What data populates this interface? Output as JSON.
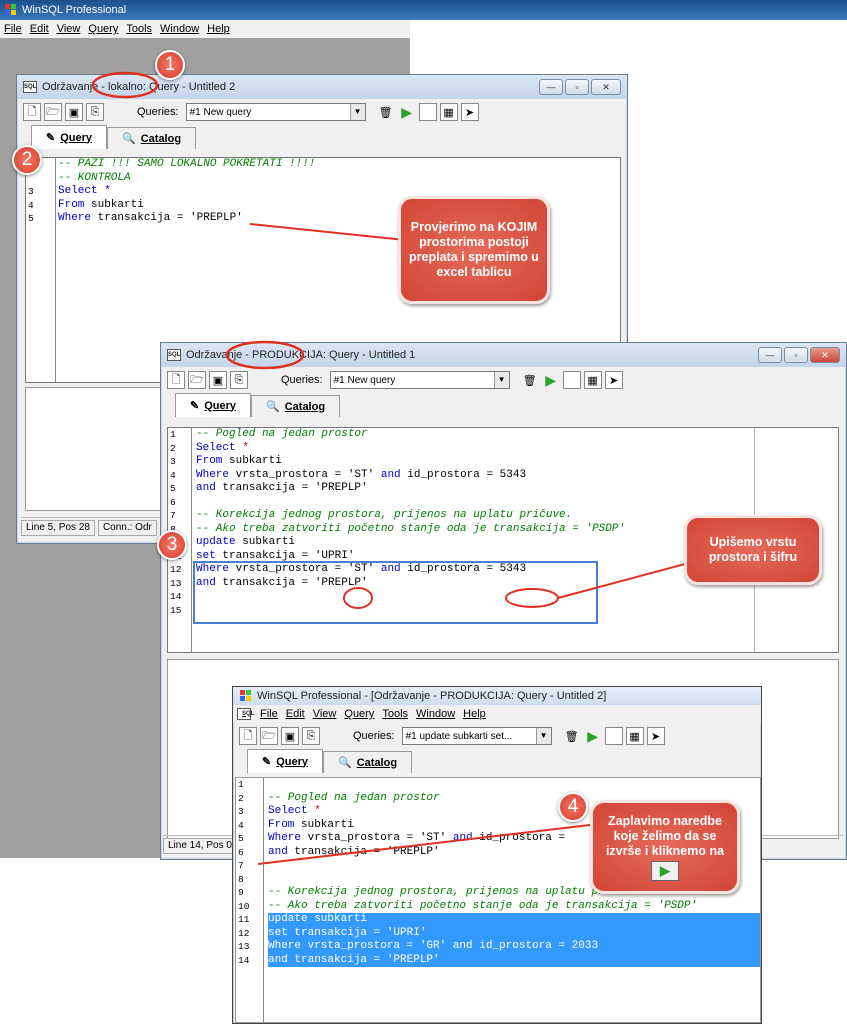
{
  "app_title": "WinSQL Professional",
  "menu": [
    "File",
    "Edit",
    "View",
    "Query",
    "Tools",
    "Window",
    "Help"
  ],
  "win1": {
    "title": "Održavanje - lokalno: Query - Untitled 2",
    "queries_label": "Queries:",
    "queries_value": "#1 New query",
    "tab_query": "Query",
    "tab_catalog": "Catalog",
    "line_numbers": [
      "",
      "",
      "3",
      "4",
      "5"
    ],
    "code": [
      {
        "t": "-- PAZI !!! SAMO LOKALNO POKRETATI !!!!",
        "c": "cmt"
      },
      {
        "t": "-- KONTROLA",
        "c": "cmt"
      },
      {
        "t": "Select *",
        "c": "kw"
      },
      {
        "t": "From subkarti",
        "c": "mix_from"
      },
      {
        "t": "Where transakcija = 'PREPLP'",
        "c": "mix_where"
      }
    ],
    "status_pos": "Line 5, Pos 28",
    "status_conn": "Conn.: Odr"
  },
  "win2": {
    "title": "Održavanje - PRODUKCIJA: Query - Untitled 1",
    "queries_label": "Queries:",
    "queries_value": "#1 New query",
    "tab_query": "Query",
    "tab_catalog": "Catalog",
    "lines": [
      {
        "n": "1",
        "t": "-- Pogled na jedan prostor",
        "c": "cmt"
      },
      {
        "n": "2",
        "t": "Select *",
        "c": "kw"
      },
      {
        "n": "3",
        "t": "From subkarti",
        "c": "from"
      },
      {
        "n": "4",
        "t": "Where vrsta_prostora = 'ST' and id_prostora = 5343",
        "c": "where"
      },
      {
        "n": "5",
        "t": "and transakcija = 'PREPLP'",
        "c": "and"
      },
      {
        "n": "6",
        "t": "",
        "c": ""
      },
      {
        "n": "7",
        "t": "-- Korekcija jednog prostora, prijenos na uplatu pričuve.",
        "c": "cmt"
      },
      {
        "n": "8",
        "t": "-- Ako treba zatvoriti početno stanje oda je transakcija = 'PSDP'",
        "c": "cmt"
      },
      {
        "n": "10",
        "t": "update subkarti",
        "c": "upd"
      },
      {
        "n": "11",
        "t": "set transakcija = 'UPRI'",
        "c": "set"
      },
      {
        "n": "12",
        "t": "Where vrsta_prostora = 'ST' and id_prostora = 5343",
        "c": "where"
      },
      {
        "n": "13",
        "t": "and transakcija = 'PREPLP'",
        "c": "and"
      },
      {
        "n": "14",
        "t": "",
        "c": ""
      },
      {
        "n": "15",
        "t": "",
        "c": ""
      }
    ],
    "status_pos": "Line 14, Pos 0"
  },
  "win3": {
    "title": "WinSQL Professional - [Održavanje - PRODUKCIJA: Query - Untitled 2]",
    "queries_label": "Queries:",
    "queries_value": "#1 update subkarti set...",
    "tab_query": "Query",
    "tab_catalog": "Catalog",
    "lines": [
      {
        "n": "1",
        "t": "",
        "c": ""
      },
      {
        "n": "2",
        "t": "-- Pogled na jedan prostor",
        "c": "cmt"
      },
      {
        "n": "3",
        "t": "Select *",
        "c": "kw"
      },
      {
        "n": "4",
        "t": "From subkarti",
        "c": "from"
      },
      {
        "n": "5",
        "t": "Where vrsta_prostora = 'ST' and id_prostora = ",
        "c": "where"
      },
      {
        "n": "6",
        "t": "and transakcija = 'PREPLP'",
        "c": "and"
      },
      {
        "n": "7",
        "t": "",
        "c": ""
      },
      {
        "n": "8",
        "t": "",
        "c": ""
      },
      {
        "n": "9",
        "t": "-- Korekcija jednog prostora, prijenos na uplatu pričuve.",
        "c": "cmt"
      },
      {
        "n": "10",
        "t": "-- Ako treba zatvoriti početno stanje oda je transakcija = 'PSDP'",
        "c": "cmt"
      },
      {
        "n": "11",
        "t": "update subkarti",
        "c": "sel"
      },
      {
        "n": "12",
        "t": "set transakcija = 'UPRI'",
        "c": "sel"
      },
      {
        "n": "13",
        "t": "Where vrsta_prostora = 'GR' and id_prostora = 2033",
        "c": "sel"
      },
      {
        "n": "14",
        "t": "and transakcija = 'PREPLP'",
        "c": "sel"
      }
    ]
  },
  "badges": [
    "1",
    "2",
    "3",
    "4"
  ],
  "callouts": {
    "c1": "Provjerimo na KOJIM prostorima postoji preplata i spremimo u excel tablicu",
    "c2": "Upišemo vrstu prostora i šifru",
    "c3": "Zaplavimo naredbe koje želimo da se izvrše i kliknemo na"
  },
  "colors": {
    "comment": "#008000",
    "keyword": "#0000cc",
    "selection": "#3399ff",
    "callout": "#d24536",
    "annotation": "#e03020",
    "highlight_box": "#4a7fd4"
  }
}
